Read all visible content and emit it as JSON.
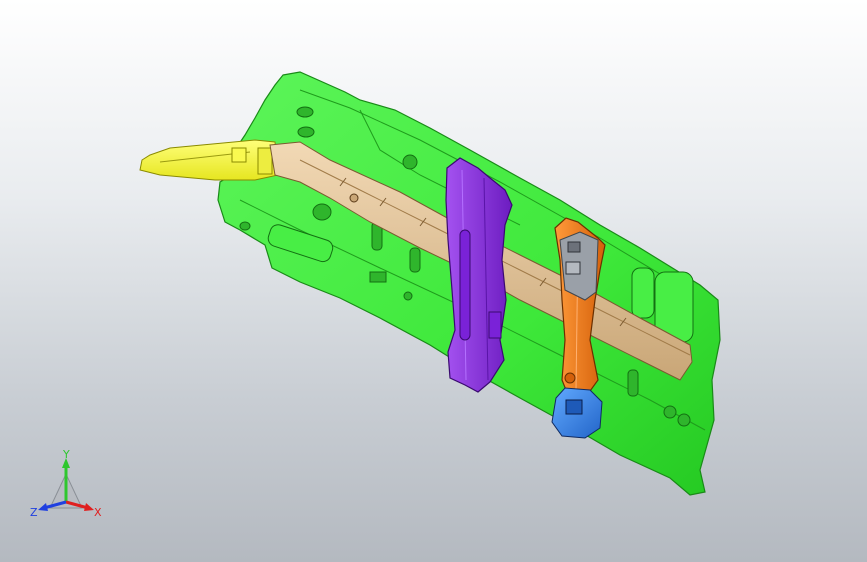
{
  "viewport": {
    "background_top": "#ffffff",
    "background_bottom": "#b4b9c0"
  },
  "model": {
    "parts": [
      {
        "name": "main-panel",
        "color": "#3ee83a"
      },
      {
        "name": "front-extension",
        "color": "#f5f53a"
      },
      {
        "name": "rail",
        "color": "#e8c79a"
      },
      {
        "name": "purple-clamp",
        "color": "#8c2ee0"
      },
      {
        "name": "orange-clamp",
        "color": "#f07a1a"
      },
      {
        "name": "gray-block",
        "color": "#8a8f98"
      },
      {
        "name": "blue-block",
        "color": "#3a8be8"
      }
    ]
  },
  "triad": {
    "y_label": "Y",
    "x_label": "X",
    "z_label": "Z",
    "y_color": "#2ec72e",
    "x_color": "#e02020",
    "z_color": "#2040e0"
  }
}
